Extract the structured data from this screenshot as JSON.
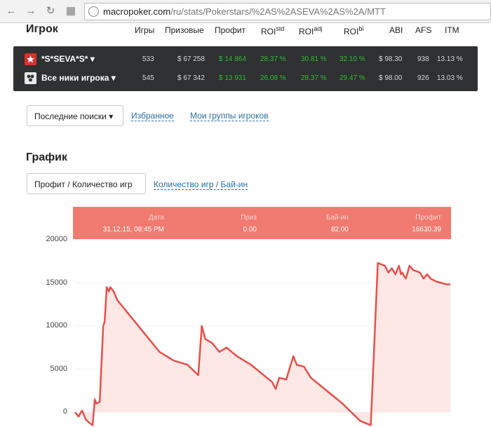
{
  "browser": {
    "url_domain": "macropoker.com",
    "url_path": "/ru/stats/Pokerstars/%2AS%2ASEVA%2AS%2A/MTT",
    "back_glyph": "←",
    "forward_glyph": "→",
    "reload_glyph": "↻",
    "apps_glyph": "▦"
  },
  "header": {
    "player": "Игрок",
    "games": "Игры",
    "prize": "Призовые",
    "profit": "Профит",
    "roi": "ROI",
    "roi_std": "std",
    "roi_adj": "adj",
    "roi_bi": "bi",
    "abi": "ABI",
    "afs": "AFS",
    "itm": "ITM"
  },
  "rows": [
    {
      "name": "*S*SEVA*S* ▾",
      "games": "533",
      "prize": "$ 67 258",
      "profit": "$ 14 864",
      "roi_std": "28.37 %",
      "roi_adj": "30.81 %",
      "roi_bi": "32.10 %",
      "abi": "$ 98.30",
      "afs": "938",
      "itm": "13.13 %",
      "icon": "pokerstars-icon",
      "icon_color": "#d9332b"
    },
    {
      "name": "Все ники игрока ▾",
      "games": "545",
      "prize": "$ 67 342",
      "profit": "$ 13 931",
      "roi_std": "26.08 %",
      "roi_adj": "28.37 %",
      "roi_bi": "29.47 %",
      "abi": "$ 98.00",
      "afs": "926",
      "itm": "13.03 %",
      "icon": "players-icon",
      "icon_color": "#e8e8e8"
    }
  ],
  "search": {
    "recent": "Последние поиски ▾",
    "favorites": "Избранное",
    "groups": "Мои группы игроков"
  },
  "graph": {
    "title": "График",
    "mode_active": "Профит / Количество игр",
    "mode_alt": "Количество игр / Бай-ин"
  },
  "tooltip": {
    "date_label": "Дата",
    "date_value": "31.12.15, 08:45 PM",
    "prize_label": "Приз",
    "prize_value": "0.00",
    "buyin_label": "Бай-ин",
    "buyin_value": "82.00",
    "profit_label": "Профит",
    "profit_value": "16630.39"
  },
  "colors": {
    "accent": "#f17a70",
    "line": "#e8504a",
    "fill": "#fde8e6",
    "panel": "#2e3032",
    "green": "#2fbe2f"
  },
  "chart_data": {
    "type": "area",
    "xlabel": "",
    "ylabel": "",
    "y_ticks": [
      "0",
      "5000",
      "10000",
      "15000",
      "20000"
    ],
    "ylim": [
      -1500,
      20000
    ],
    "x": [
      0,
      5,
      10,
      15,
      20,
      25,
      28,
      30,
      35,
      40,
      42,
      45,
      48,
      50,
      55,
      60,
      80,
      100,
      120,
      140,
      160,
      175,
      180,
      185,
      195,
      205,
      215,
      230,
      250,
      265,
      280,
      285,
      290,
      300,
      310,
      315,
      325,
      335,
      350,
      365,
      380,
      395,
      405,
      420,
      430,
      440,
      445,
      450,
      455,
      460,
      463,
      465,
      468,
      470,
      475,
      480,
      490,
      495,
      500,
      505,
      512,
      520,
      530,
      533
    ],
    "y": [
      0,
      -500,
      200,
      -800,
      -1200,
      -1500,
      1500,
      1000,
      1200,
      10000,
      10500,
      14500,
      14000,
      14500,
      14000,
      13000,
      11000,
      9000,
      7000,
      6000,
      5500,
      4300,
      10000,
      8500,
      8000,
      7000,
      7500,
      6500,
      5500,
      4500,
      3500,
      2700,
      4000,
      3800,
      6500,
      5500,
      5300,
      4000,
      3000,
      2000,
      1000,
      -200,
      -1000,
      -1500,
      17300,
      17000,
      16200,
      16700,
      16000,
      17000,
      16000,
      16200,
      15700,
      15500,
      17000,
      16500,
      16200,
      15500,
      16000,
      15500,
      15200,
      15000,
      14800,
      14864
    ]
  }
}
